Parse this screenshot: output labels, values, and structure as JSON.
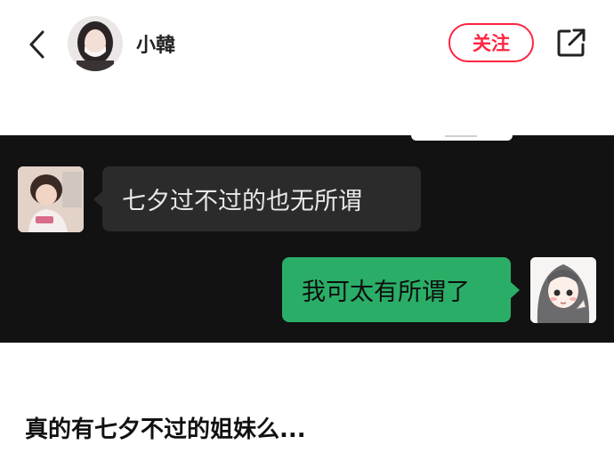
{
  "header": {
    "username": "小韓",
    "follow_label": "关注"
  },
  "chat": {
    "incoming_message": "七夕过不过的也无所谓",
    "outgoing_message": "我可太有所谓了"
  },
  "post": {
    "title": "真的有七夕不过的姐妹么..."
  },
  "icons": [
    "back-icon",
    "share-icon"
  ],
  "colors": {
    "accent": "#ff2442",
    "chat_background": "#121212",
    "incoming_bubble": "#2b2b2b",
    "outgoing_bubble": "#2aae67"
  }
}
